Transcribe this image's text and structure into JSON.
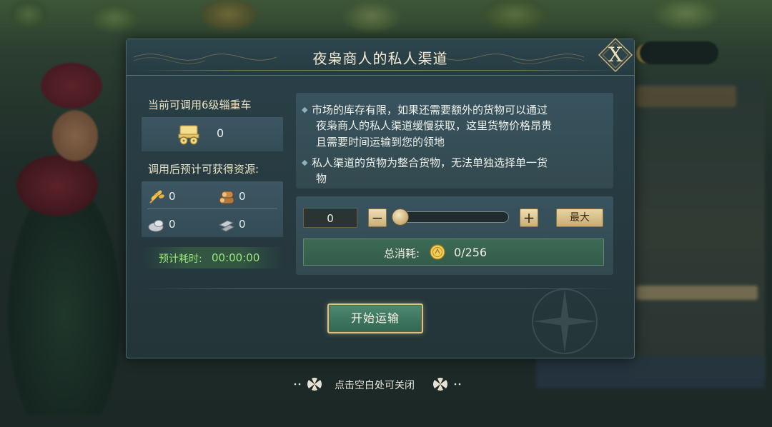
{
  "dialog": {
    "title": "夜枭商人的私人渠道",
    "close_glyph": "X"
  },
  "wagon": {
    "label": "当前可调用6级辎重车",
    "count": "0"
  },
  "resources": {
    "label": "调用后预计可获得资源:",
    "items": [
      {
        "name": "food",
        "icon": "wheat-icon",
        "value": "0"
      },
      {
        "name": "wood",
        "icon": "log-icon",
        "value": "0"
      },
      {
        "name": "stone",
        "icon": "stone-icon",
        "value": "0"
      },
      {
        "name": "iron",
        "icon": "iron-icon",
        "value": "0"
      }
    ]
  },
  "eta": {
    "label": "预计耗时:",
    "value": "00:00:00"
  },
  "info": {
    "bullet1_line1": "市场的库存有限，如果还需要额外的货物可以通过",
    "bullet1_line2": "夜枭商人的私人渠道缓慢获取，这里货物价格昂贵",
    "bullet1_line3": "且需要时间运输到您的领地",
    "bullet2_line1": "私人渠道的货物为整合货物，无法单独选择单一货",
    "bullet2_line2": "物"
  },
  "quantity": {
    "value": "0",
    "minus": "−",
    "plus": "+",
    "max_label": "最大",
    "slider_fraction": 0
  },
  "cost": {
    "label": "总消耗:",
    "value": "0/256"
  },
  "start_button": "开始运输",
  "close_hint": "点击空白处可关闭",
  "colors": {
    "accent_gold": "#d7c28a",
    "eta_green": "#9ce67a",
    "panel_teal": "#26393f"
  }
}
